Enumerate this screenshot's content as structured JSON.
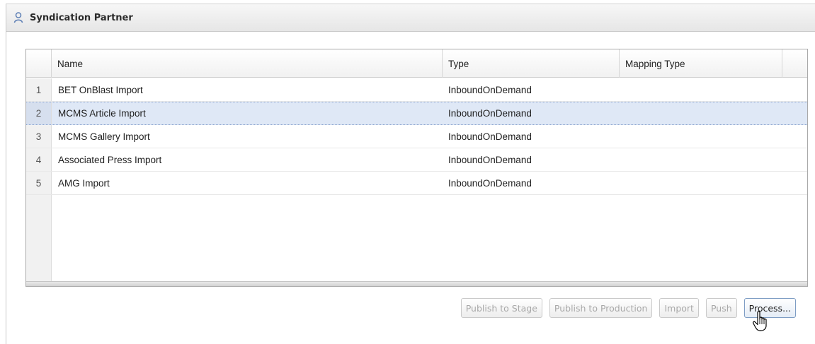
{
  "panel": {
    "title": "Syndication Partner",
    "icon": "user-icon"
  },
  "grid": {
    "columns": {
      "name": "Name",
      "type": "Type",
      "mapping_type": "Mapping Type"
    },
    "rows": [
      {
        "num": "1",
        "name": "BET OnBlast Import",
        "type": "InboundOnDemand",
        "mapping_type": "",
        "selected": false
      },
      {
        "num": "2",
        "name": "MCMS Article Import",
        "type": "InboundOnDemand",
        "mapping_type": "",
        "selected": true
      },
      {
        "num": "3",
        "name": "MCMS Gallery Import",
        "type": "InboundOnDemand",
        "mapping_type": "",
        "selected": false
      },
      {
        "num": "4",
        "name": "Associated Press Import",
        "type": "InboundOnDemand",
        "mapping_type": "",
        "selected": false
      },
      {
        "num": "5",
        "name": "AMG Import",
        "type": "InboundOnDemand",
        "mapping_type": "",
        "selected": false
      }
    ]
  },
  "toolbar": {
    "publish_stage": "Publish to Stage",
    "publish_production": "Publish to Production",
    "import": "Import",
    "push": "Push",
    "process": "Process..."
  },
  "cursor": "hand-pointer-icon",
  "colors": {
    "selected_row": "#dfe8f6",
    "disabled_text": "#a8a8a8",
    "active_border": "#7e9dc4"
  }
}
